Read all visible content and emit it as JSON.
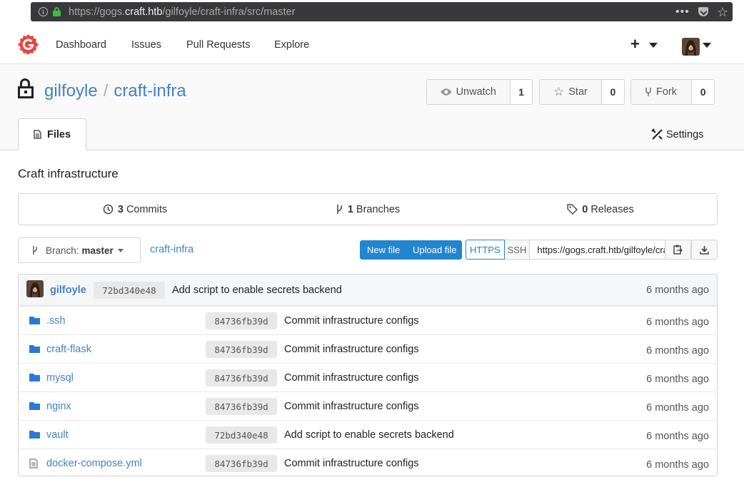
{
  "browser": {
    "url_prefix": "https://gogs.",
    "url_host": "craft.htb",
    "url_path": "/gilfoyle/craft-infra/src/master",
    "menu_dots": "•••"
  },
  "nav": {
    "items": [
      "Dashboard",
      "Issues",
      "Pull Requests",
      "Explore"
    ],
    "plus": "+"
  },
  "repo": {
    "owner": "gilfoyle",
    "separator": "/",
    "name": "craft-infra",
    "watch": {
      "label": "Unwatch",
      "count": "1"
    },
    "star": {
      "label": "Star",
      "count": "0"
    },
    "fork": {
      "label": "Fork",
      "count": "0"
    },
    "tab_files": "Files",
    "tab_settings": "Settings",
    "description": "Craft infrastructure"
  },
  "stats": {
    "commits": {
      "count": "3",
      "label": "Commits"
    },
    "branches": {
      "count": "1",
      "label": "Branches"
    },
    "releases": {
      "count": "0",
      "label": "Releases"
    }
  },
  "toolbar": {
    "branch_prefix": "Branch:",
    "branch": "master",
    "breadcrumb": "craft-infra",
    "new_file": "New file",
    "upload_file": "Upload file",
    "https": "HTTPS",
    "ssh": "SSH",
    "clone_url": "https://gogs.craft.htb/gilfoyle/craft-infra.git"
  },
  "last_commit": {
    "author": "gilfoyle",
    "sha": "72bd340e48",
    "message": "Add script to enable secrets backend",
    "age": "6 months ago"
  },
  "files": [
    {
      "name": ".ssh",
      "type": "folder",
      "sha": "84736fb39d",
      "message": "Commit infrastructure configs",
      "age": "6 months ago"
    },
    {
      "name": "craft-flask",
      "type": "folder",
      "sha": "84736fb39d",
      "message": "Commit infrastructure configs",
      "age": "6 months ago"
    },
    {
      "name": "mysql",
      "type": "folder",
      "sha": "84736fb39d",
      "message": "Commit infrastructure configs",
      "age": "6 months ago"
    },
    {
      "name": "nginx",
      "type": "folder",
      "sha": "84736fb39d",
      "message": "Commit infrastructure configs",
      "age": "6 months ago"
    },
    {
      "name": "vault",
      "type": "folder",
      "sha": "72bd340e48",
      "message": "Add script to enable secrets backend",
      "age": "6 months ago"
    },
    {
      "name": "docker-compose.yml",
      "type": "file",
      "sha": "84736fb39d",
      "message": "Commit infrastructure configs",
      "age": "6 months ago"
    }
  ],
  "colors": {
    "link": "#4183c4",
    "primary": "#2185d0",
    "folder": "#2a7ad3",
    "logo": "#e8463f"
  }
}
